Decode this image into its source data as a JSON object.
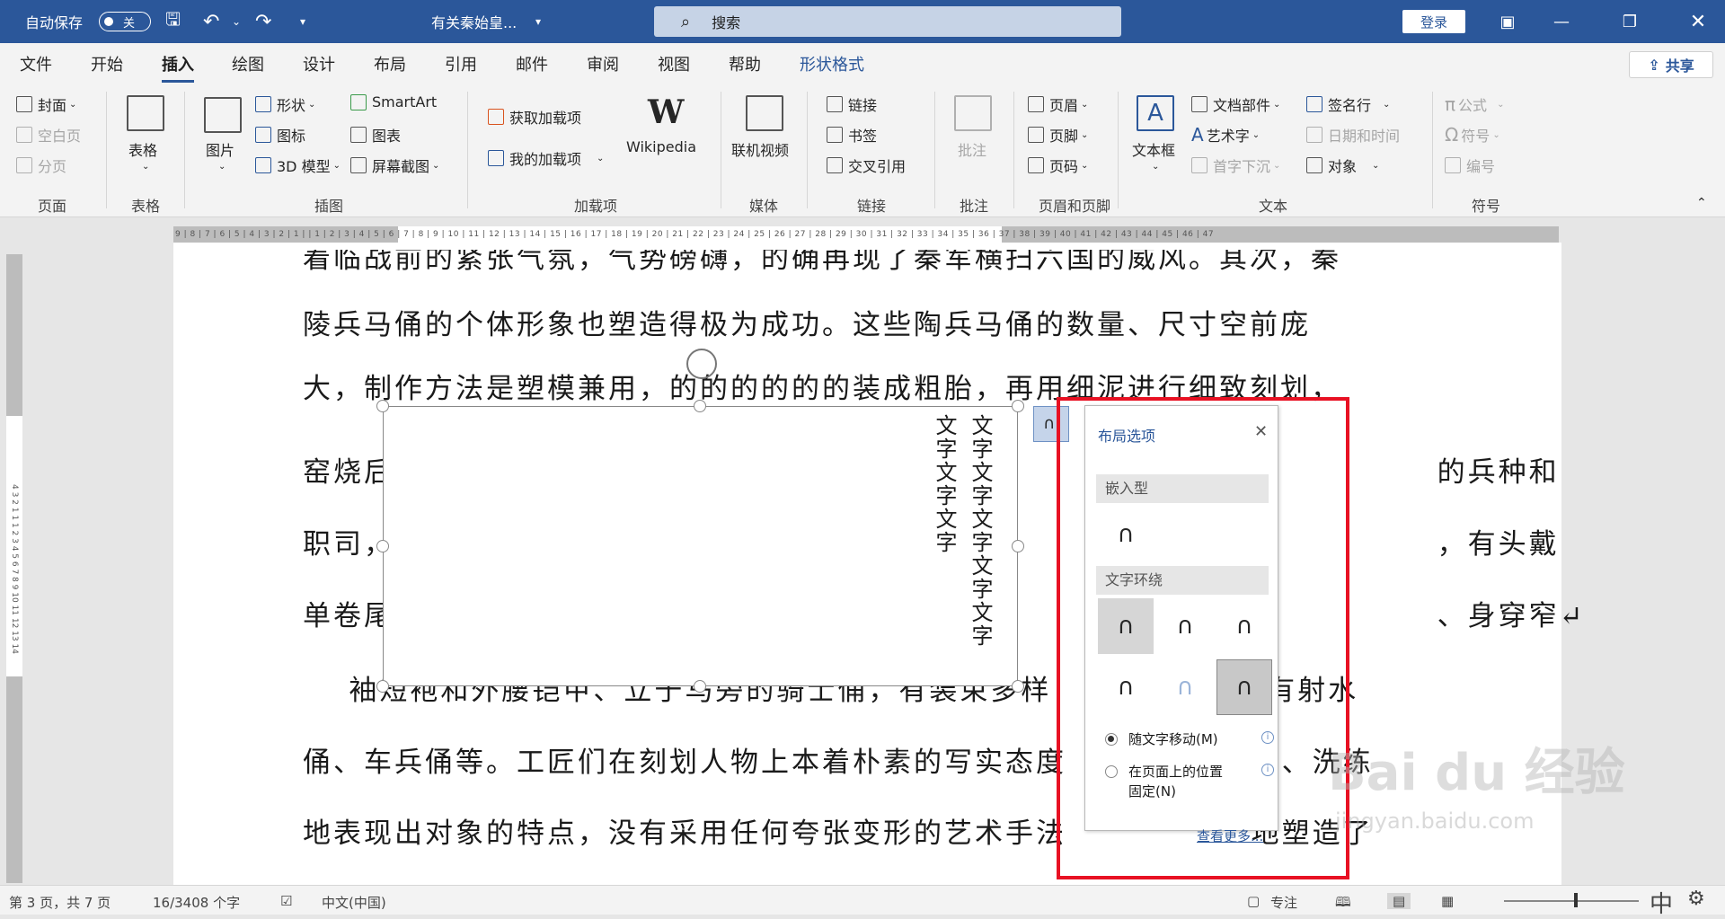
{
  "titlebar": {
    "autosave_label": "自动保存",
    "autosave_state": "关",
    "doc_title": "有关秦始皇...",
    "search_placeholder": "搜索",
    "login_label": "登录"
  },
  "tabs": [
    "文件",
    "开始",
    "插入",
    "绘图",
    "设计",
    "布局",
    "引用",
    "邮件",
    "审阅",
    "视图",
    "帮助",
    "形状格式"
  ],
  "active_tab": "插入",
  "share_label": "共享",
  "ribbon": {
    "pages": {
      "cover": "封面",
      "blank": "空白页",
      "break": "分页",
      "label": "页面"
    },
    "tables": {
      "table": "表格",
      "label": "表格"
    },
    "illus": {
      "picture": "图片",
      "shapes": "形状",
      "icons": "图标",
      "model3d": "3D 模型",
      "smartart": "SmartArt",
      "chart": "图表",
      "screenshot": "屏幕截图",
      "label": "插图"
    },
    "addins": {
      "get": "获取加载项",
      "my": "我的加载项",
      "wiki": "Wikipedia",
      "label": "加载项"
    },
    "media": {
      "video": "联机视频",
      "label": "媒体"
    },
    "links": {
      "link": "链接",
      "bookmark": "书签",
      "xref": "交叉引用",
      "label": "链接"
    },
    "comments": {
      "comment": "批注",
      "label": "批注"
    },
    "hf": {
      "header": "页眉",
      "footer": "页脚",
      "pagenum": "页码",
      "label": "页眉和页脚"
    },
    "text": {
      "textbox": "文本框",
      "parts": "文档部件",
      "wordart": "艺术字",
      "dropcap": "首字下沉",
      "sigline": "签名行",
      "datetime": "日期和时间",
      "object": "对象",
      "label": "文本"
    },
    "symbols": {
      "equation": "公式",
      "symbol": "符号",
      "number": "编号",
      "label": "符号"
    }
  },
  "ruler_text": "9 | 8 | 7 | 6 | 5 | 4 | 3 | 2 | 1 |     | 1 | 2 | 3 | 4 | 5 | 6 | 7 | 8 | 9 | 10 | 11 | 12 | 13 | 14 | 15 | 16 | 17 | 18 | 19 | 20 | 21 | 22 | 23 | 24 | 25 | 26 | 27 | 28 | 29 | 30 | 31 | 32 | 33 | 34 | 35 | 36 | 37 | 38 | 39 | 40 | 41 | 42 | 43 | 44 | 45 | 46 | 47",
  "vruler_text": "4 3 2 1 1 1 2 3 4 5 6 7 8 9 10 11 12 13 14",
  "document": {
    "lines": [
      "着临战前的紧张气氛，气势磅礴，的确再现了秦军横扫六国的威风。其次，秦",
      "陵兵马俑的个体形象也塑造得极为成功。这些陶兵马俑的数量、尺寸空前庞",
      "大，制作方法是塑模兼用，的的的的的的装成粗胎，再用细泥进行细致刻划，",
      "窑烧后                                                                     在位                的兵种和",
      "职司，                                                                     手按                ，有头戴",
      "单卷尾                                                                     ，有                、身穿窄↵",
      "    袖短袍和外腰铠甲、立于马旁的骑士俑，有装束多样                还有射水",
      "俑、车兵俑等。工匠们在刻划人物上本着朴素的写实态度                确、洗练",
      "地表现出对象的特点，没有采用任何夸张变形的艺术手法                地塑造了"
    ],
    "textbox_col1": "文字文字文字",
    "textbox_col2": "文字文字文字文字文字"
  },
  "layout_panel": {
    "title": "布局选项",
    "inline_section": "嵌入型",
    "wrap_section": "文字环绕",
    "move_with_text": "随文字移动(M)",
    "fix_position_l1": "在页面上的位置",
    "fix_position_l2": "固定(N)",
    "see_more": "查看更多..."
  },
  "statusbar": {
    "page": "第 3 页，共 7 页",
    "words": "16/3408 个字",
    "lang": "中文(中国)",
    "focus": "专注",
    "ime": "中"
  },
  "watermark": {
    "logo": "Bai du 经验",
    "url": "jingyan.baidu.com"
  },
  "colors": {
    "brand": "#2b579a",
    "highlight": "#e81123"
  }
}
